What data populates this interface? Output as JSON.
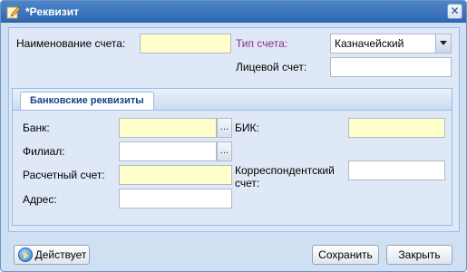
{
  "window": {
    "title": "*Реквизит"
  },
  "form": {
    "account_name_label": "Наименование счета:",
    "account_name_value": "",
    "account_type_label": "Тип счета:",
    "account_type_value": "Казначейский",
    "personal_account_label": "Лицевой счет:",
    "personal_account_value": ""
  },
  "bank_tab": {
    "title": "Банковские реквизиты",
    "bank_label": "Банк:",
    "bank_value": "",
    "branch_label": "Филиал:",
    "branch_value": "",
    "settlement_label": "Расчетный счет:",
    "settlement_value": "",
    "address_label": "Адрес:",
    "address_value": "",
    "bik_label": "БИК:",
    "bik_value": "",
    "corr_label_line1": "Корреспондентский",
    "corr_label_line2": "счет:",
    "corr_value": "",
    "lookup_glyph": "..."
  },
  "footer": {
    "status_label": "Действует",
    "save_label": "Сохранить",
    "close_label": "Закрыть"
  },
  "icons": {
    "title": "edit-document-icon",
    "close": "close-icon",
    "status": "play-status-icon",
    "dropdown": "chevron-down-icon"
  },
  "colors": {
    "titlebar": "#2f68b3",
    "required_field": "#ffffcc",
    "type_label": "#8b2f8b",
    "tab_text": "#15428b"
  }
}
